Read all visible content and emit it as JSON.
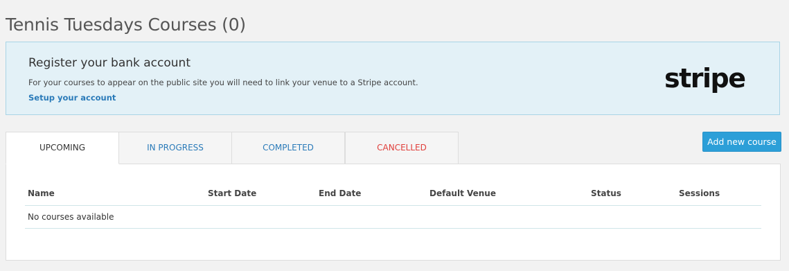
{
  "page": {
    "title": "Tennis Tuesdays Courses (0)"
  },
  "banner": {
    "title": "Register your bank account",
    "text": "For your courses to appear on the public site you will need to link your venue to a Stripe account.",
    "link": "Setup your account",
    "logo": "stripe"
  },
  "tabs": [
    {
      "label": "UPCOMING"
    },
    {
      "label": "IN PROGRESS"
    },
    {
      "label": "COMPLETED"
    },
    {
      "label": "CANCELLED"
    }
  ],
  "toolbar": {
    "add_label": "Add new course"
  },
  "table": {
    "headers": [
      "Name",
      "Start Date",
      "End Date",
      "Default Venue",
      "Status",
      "Sessions"
    ],
    "empty_message": "No courses available"
  },
  "colors": {
    "accent": "#2c9fd8",
    "link": "#2b7bb9",
    "cancelled": "#e0403c",
    "banner_bg": "#e3f1f7"
  }
}
